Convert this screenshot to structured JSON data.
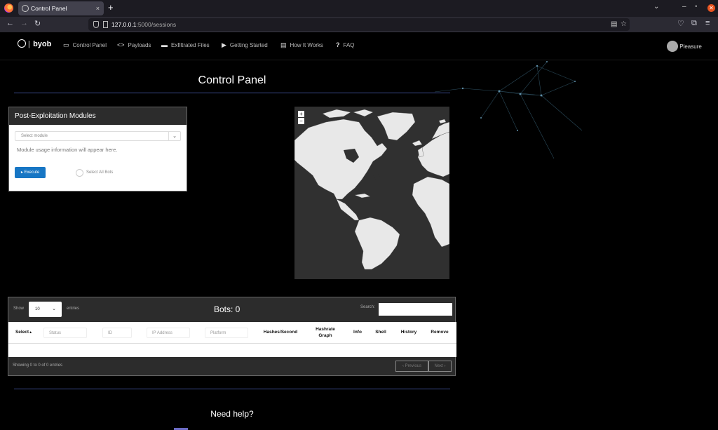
{
  "browser": {
    "tab_title": "Control Panel",
    "tab_close": "×",
    "new_tab": "+",
    "url_host": "127.0.0.1",
    "url_path": ":5000/sessions",
    "back": "←",
    "forward": "→",
    "reload": "↻"
  },
  "nav": {
    "brand": "byob",
    "links": [
      {
        "icon": "monitor-icon",
        "label": "Control Panel"
      },
      {
        "icon": "code-icon",
        "label": "Payloads"
      },
      {
        "icon": "folder-icon",
        "label": "Exfiltrated Files"
      },
      {
        "icon": "play-icon",
        "label": "Getting Started"
      },
      {
        "icon": "document-icon",
        "label": "How It Works"
      },
      {
        "icon": "question-icon",
        "label": "FAQ"
      }
    ],
    "user": "Pleasure"
  },
  "page": {
    "title": "Control Panel",
    "help": "Need help?"
  },
  "modules": {
    "header": "Post-Exploitation Modules",
    "select_placeholder": "Select module",
    "usage_info": "Module usage information will appear here.",
    "execute": "Execute",
    "select_all": "Select All Bots"
  },
  "map": {
    "zoom_in": "+",
    "zoom_out": "−"
  },
  "bots": {
    "show": "Show",
    "page_length": "10",
    "entries": "entries",
    "title": "Bots: 0",
    "search": "Search:",
    "columns": {
      "select": "Select",
      "status": "Status",
      "id": "ID",
      "ip": "IP Address",
      "platform": "Platform",
      "hashes": "Hashes/Second",
      "hashrate": "Hashrate Graph",
      "info": "Info",
      "shell": "Shell",
      "history": "History",
      "remove": "Remove"
    },
    "info": "Showing 0 to 0 of 0 entries",
    "previous": "‹ Previous",
    "next": "Next ›"
  }
}
